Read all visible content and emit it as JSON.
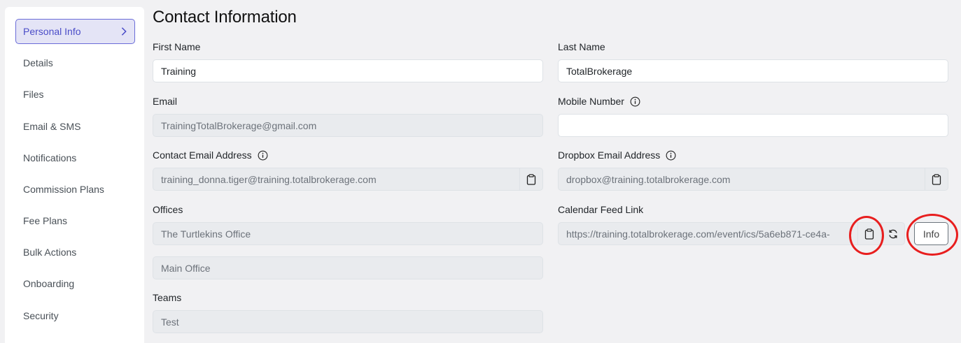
{
  "sidebar": {
    "items": [
      {
        "label": "Personal Info"
      },
      {
        "label": "Details"
      },
      {
        "label": "Files"
      },
      {
        "label": "Email & SMS"
      },
      {
        "label": "Notifications"
      },
      {
        "label": "Commission Plans"
      },
      {
        "label": "Fee Plans"
      },
      {
        "label": "Bulk Actions"
      },
      {
        "label": "Onboarding"
      },
      {
        "label": "Security"
      }
    ]
  },
  "main": {
    "title": "Contact Information",
    "first_name": {
      "label": "First Name",
      "value": "Training"
    },
    "last_name": {
      "label": "Last Name",
      "value": "TotalBrokerage"
    },
    "email": {
      "label": "Email",
      "value": "TrainingTotalBrokerage@gmail.com"
    },
    "mobile_number": {
      "label": "Mobile Number",
      "value": ""
    },
    "contact_email": {
      "label": "Contact Email Address",
      "value": "training_donna.tiger@training.totalbrokerage.com"
    },
    "dropbox_email": {
      "label": "Dropbox Email Address",
      "value": "dropbox@training.totalbrokerage.com"
    },
    "offices": {
      "label": "Offices",
      "values": [
        "The Turtlekins Office",
        "Main Office"
      ]
    },
    "calendar_feed": {
      "label": "Calendar Feed Link",
      "value": "https://training.totalbrokerage.com/event/ics/5a6eb871-ce4a-",
      "info_button": "Info"
    },
    "teams": {
      "label": "Teams",
      "value": "Test"
    }
  },
  "colors": {
    "accent": "#6a6cd8",
    "annotation": "#e81e1e"
  }
}
